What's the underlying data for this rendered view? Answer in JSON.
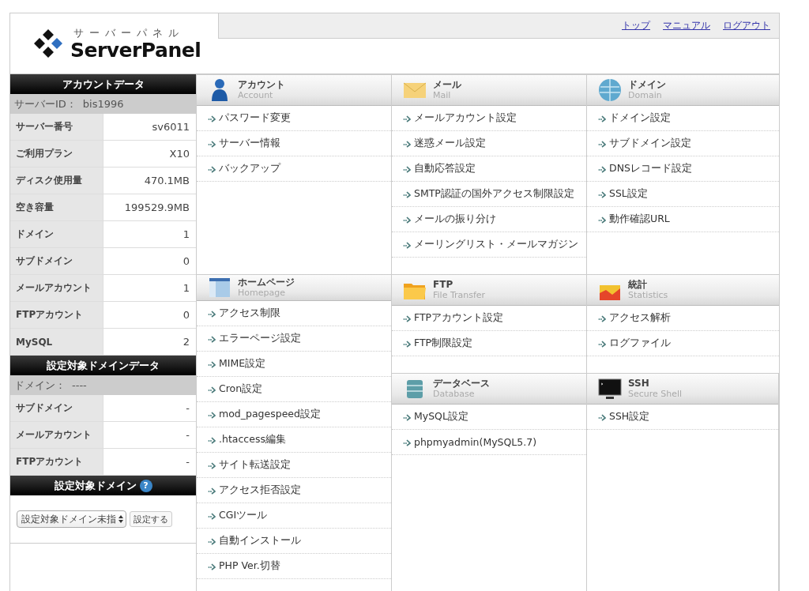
{
  "logo": {
    "kana": "サーバーパネル",
    "name": "ServerPanel"
  },
  "top_links": [
    "トップ",
    "マニュアル",
    "ログアウト"
  ],
  "sidebar": {
    "account_data": {
      "title": "アカウントデータ",
      "id_label": "サーバーID：",
      "id_value": "bis1996",
      "rows": [
        {
          "label": "サーバー番号",
          "value": "sv6011"
        },
        {
          "label": "ご利用プラン",
          "value": "X10"
        },
        {
          "label": "ディスク使用量",
          "value": "470.1MB"
        },
        {
          "label": "空き容量",
          "value": "199529.9MB"
        },
        {
          "label": "ドメイン",
          "value": "1"
        },
        {
          "label": "サブドメイン",
          "value": "0"
        },
        {
          "label": "メールアカウント",
          "value": "1"
        },
        {
          "label": "FTPアカウント",
          "value": "0"
        },
        {
          "label": "MySQL",
          "value": "2"
        }
      ]
    },
    "domain_data": {
      "title": "設定対象ドメインデータ",
      "id_label": "ドメイン：",
      "id_value": "----",
      "rows": [
        {
          "label": "サブドメイン",
          "value": "-"
        },
        {
          "label": "メールアカウント",
          "value": "-"
        },
        {
          "label": "FTPアカウント",
          "value": "-"
        }
      ]
    },
    "domain_select": {
      "title": "設定対象ドメイン",
      "help": "?",
      "select_value": "設定対象ドメイン未指",
      "button": "設定する"
    }
  },
  "sections": [
    {
      "kind": "account",
      "title": "アカウント",
      "subtitle": "Account",
      "items": [
        "パスワード変更",
        "サーバー情報",
        "バックアップ"
      ]
    },
    {
      "kind": "mail",
      "title": "メール",
      "subtitle": "Mail",
      "items": [
        "メールアカウント設定",
        "迷惑メール設定",
        "自動応答設定",
        "SMTP認証の国外アクセス制限設定",
        "メールの振り分け",
        "メーリングリスト・メールマガジン"
      ]
    },
    {
      "kind": "domain",
      "title": "ドメイン",
      "subtitle": "Domain",
      "items": [
        "ドメイン設定",
        "サブドメイン設定",
        "DNSレコード設定",
        "SSL設定",
        "動作確認URL"
      ]
    },
    {
      "kind": "homepage",
      "title": "ホームページ",
      "subtitle": "Homepage",
      "items": [
        "アクセス制限",
        "エラーページ設定",
        "MIME設定",
        "Cron設定",
        "mod_pagespeed設定",
        ".htaccess編集",
        "サイト転送設定",
        "アクセス拒否設定",
        "CGIツール",
        "自動インストール",
        "PHP Ver.切替"
      ]
    },
    {
      "kind": "ftp",
      "title": "FTP",
      "subtitle": "File Transfer",
      "items": [
        "FTPアカウント設定",
        "FTP制限設定"
      ]
    },
    {
      "kind": "statistics",
      "title": "統計",
      "subtitle": "Statistics",
      "items": [
        "アクセス解析",
        "ログファイル"
      ]
    },
    {
      "kind": "database",
      "title": "データベース",
      "subtitle": "Database",
      "items": [
        "MySQL設定",
        "phpmyadmin(MySQL5.7)"
      ]
    },
    {
      "kind": "ssh",
      "title": "SSH",
      "subtitle": "Secure Shell",
      "items": [
        "SSH設定"
      ]
    }
  ]
}
